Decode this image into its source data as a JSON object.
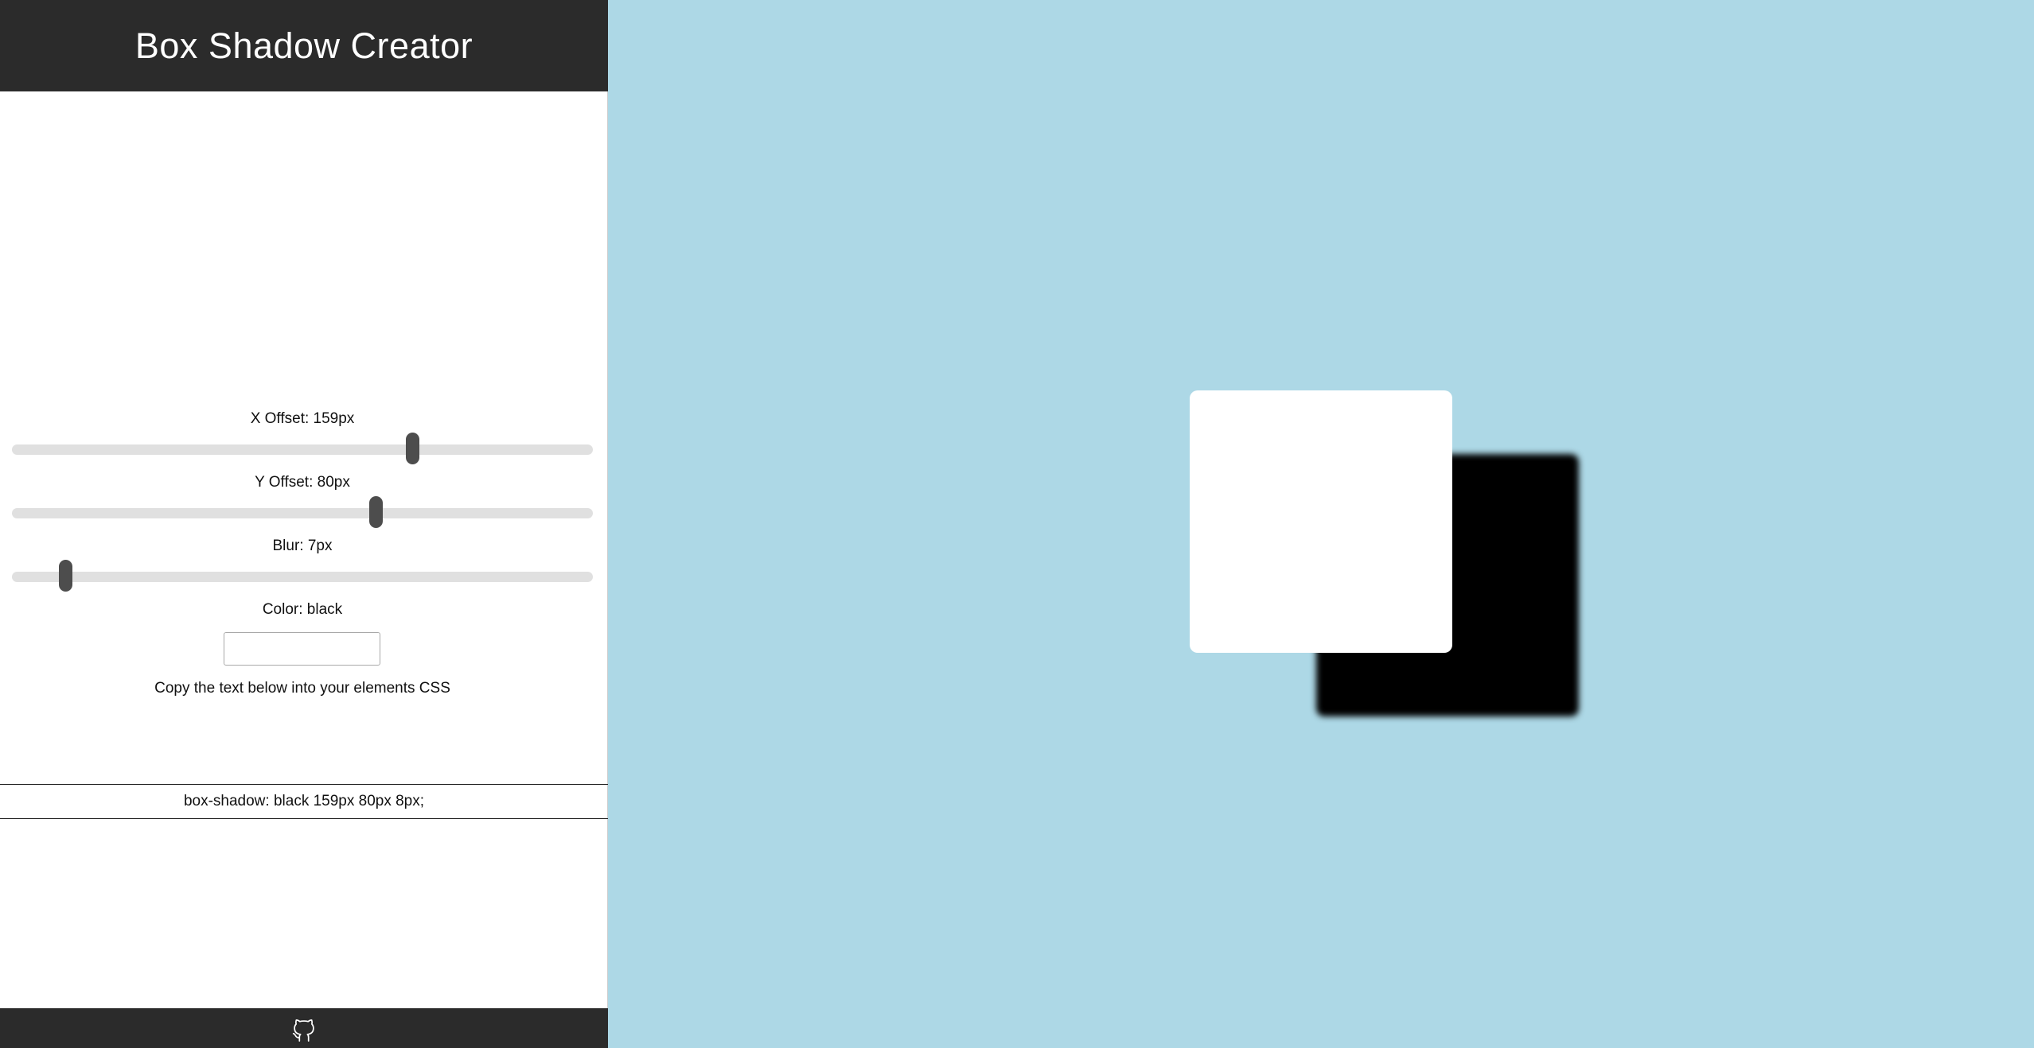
{
  "header": {
    "title": "Box Shadow Creator"
  },
  "controls": {
    "x_offset": {
      "label": "X Offset: 159px",
      "min": -400,
      "max": 400,
      "value": 159
    },
    "y_offset": {
      "label": "Y Offset: 80px",
      "min": -300,
      "max": 300,
      "value": 80
    },
    "blur": {
      "label": "Blur: 7px",
      "min": 0,
      "max": 100,
      "value": 7
    },
    "color": {
      "label": "Color: black",
      "value": ""
    }
  },
  "copy_hint": "Copy the text below into your elements CSS",
  "css_output": "box-shadow: black 159px 80px 8px;",
  "footer": {
    "icon": "github-icon"
  },
  "colors": {
    "header_bg": "#2b2b2b",
    "preview_bg": "#add8e6",
    "shadow": "#000000",
    "box": "#ffffff"
  }
}
